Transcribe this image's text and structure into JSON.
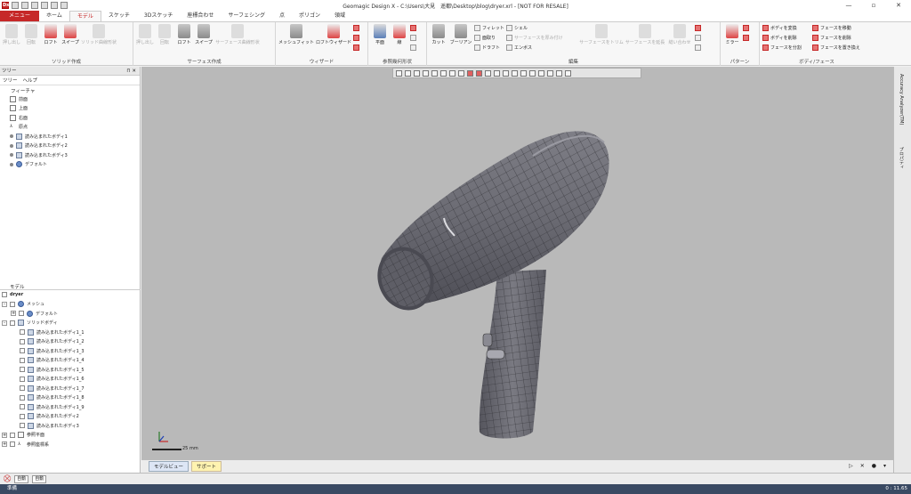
{
  "window": {
    "title": "Geomagic Design X - C:\\Users\\大見　遥都\\Desktop\\blog\\dryer.xrl - [NOT FOR RESALE]",
    "minimize": "—",
    "maximize": "▫",
    "close": "✕"
  },
  "tabs": [
    "メニュー",
    "ホーム",
    "モデル",
    "スケッチ",
    "3Dスケッチ",
    "座標合わせ",
    "サーフェシング",
    "点",
    "ポリゴン",
    "領域"
  ],
  "active_tab": "モデル",
  "ribbon": {
    "solid_group": {
      "label": "ソリッド作成",
      "buttons": [
        "押し出し",
        "回転",
        "ロフト",
        "スイープ",
        "ソリッド曲線形状"
      ]
    },
    "surface_group": {
      "label": "サーフェス作成",
      "buttons": [
        "押し出し",
        "回転",
        "ロフト",
        "スイープ",
        "サーフェース曲線形状"
      ]
    },
    "wizard_group": {
      "label": "ウィザード",
      "buttons": [
        "メッシュフィット",
        "ロフトウィザード"
      ]
    },
    "ref_group": {
      "label": "参照幾何形状",
      "buttons": [
        "平面",
        "線"
      ]
    },
    "edit_group": {
      "label": "編集",
      "buttons": [
        "カット",
        "ブーリアン"
      ],
      "small": [
        "フィレット",
        "面取り",
        "ドラフト",
        "シェル",
        "サーフェースを厚み付け",
        "エンボス",
        "サーフェースをトリム",
        "サーフェースを延長",
        "縫い合わせ"
      ]
    },
    "pattern_group": {
      "label": "パターン",
      "buttons": [
        "ミラー"
      ]
    },
    "bodyface_group": {
      "label": "ボディ/フェース",
      "small": [
        "ボディを変換",
        "ボディを削除",
        "フェースを分割",
        "フェースを移動",
        "フェースを削除",
        "フェースを置き換え"
      ]
    }
  },
  "left_panel": {
    "title": "ツリー",
    "subtabs": [
      "ツリー",
      "ヘルプ"
    ],
    "feature_label": "フィーチャ",
    "features": [
      "前面",
      "上面",
      "右面",
      "原点",
      "読み込まれたボディ1",
      "読み込まれたボディ2",
      "読み込まれたボディ3",
      "デフォルト"
    ],
    "model_label": "モデル",
    "model_root": "dryer",
    "mesh_label": "メッシュ",
    "mesh_default": "デフォルト",
    "solid_label": "ソリッドボディ",
    "solid_bodies": [
      "読み込まれたボディ1_1",
      "読み込まれたボディ1_2",
      "読み込まれたボディ1_3",
      "読み込まれたボディ1_4",
      "読み込まれたボディ1_5",
      "読み込まれたボディ1_6",
      "読み込まれたボディ1_7",
      "読み込まれたボディ1_8",
      "読み込まれたボディ1_9",
      "読み込まれたボディ2",
      "読み込まれたボディ3"
    ],
    "ref_plane": "参照平面",
    "ref_coord": "参照座標系"
  },
  "viewport": {
    "scale_label": "25 mm"
  },
  "bottom_tabs": [
    "モデルビュー",
    "サポート"
  ],
  "right_tabs": [
    "Accuracy Analyzer(TM)",
    "プロパティ"
  ],
  "bottom_selects": [
    "自動",
    "自動"
  ],
  "status": {
    "left": "準備",
    "right": "0 : 11.65"
  }
}
